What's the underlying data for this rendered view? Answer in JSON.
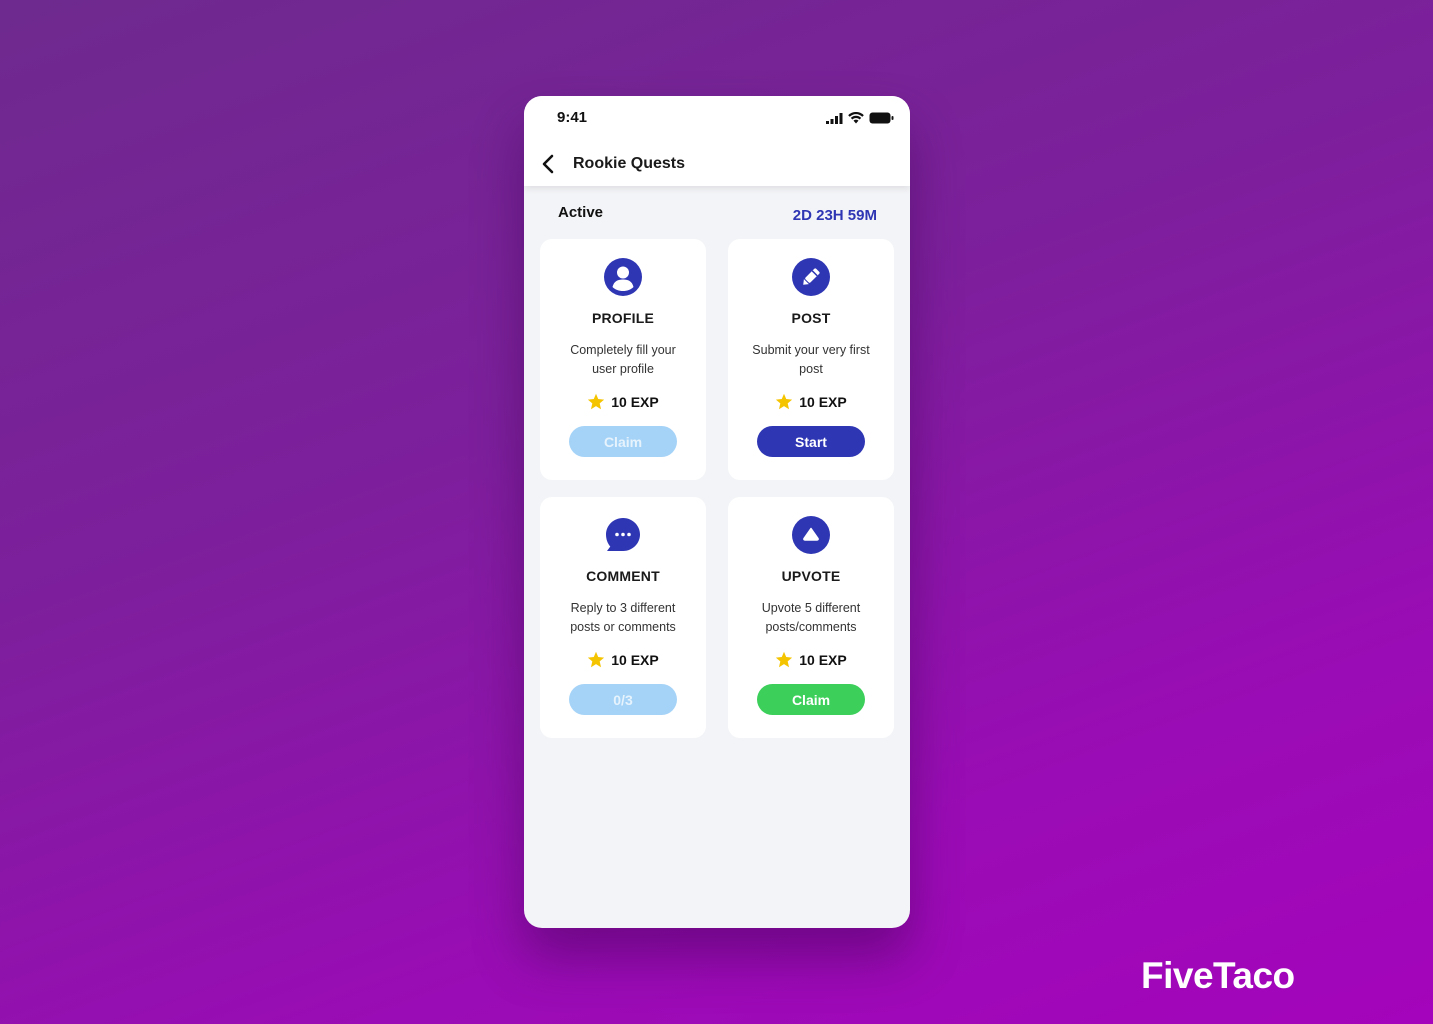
{
  "status_bar": {
    "time": "9:41",
    "icons": [
      "signal-icon",
      "wifi-icon",
      "battery-icon"
    ]
  },
  "header": {
    "title": "Rookie Quests",
    "back_icon": "chevron-left-icon"
  },
  "section": {
    "label": "Active",
    "timer": "2D 23H 59M"
  },
  "quests": [
    {
      "icon": "user-icon",
      "title": "PROFILE",
      "description": "Completely fill your user profile",
      "reward": "10 EXP",
      "button": "Claim",
      "button_state": "disabled"
    },
    {
      "icon": "pencil-icon",
      "title": "POST",
      "description": "Submit your very first post",
      "reward": "10 EXP",
      "button": "Start",
      "button_state": "primary"
    },
    {
      "icon": "comment-icon",
      "title": "COMMENT",
      "description": "Reply to 3 different posts or comments",
      "reward": "10 EXP",
      "button": "0/3",
      "button_state": "disabled",
      "progress": {
        "done": 0,
        "total": 3
      }
    },
    {
      "icon": "upvote-icon",
      "title": "UPVOTE",
      "description": "Upvote 5 different posts/comments",
      "reward": "10 EXP",
      "button": "Claim",
      "button_state": "success"
    }
  ],
  "colors": {
    "accent": "#2f36b4",
    "success": "#3ccf5a",
    "disabled": "#a5d3f7",
    "star": "#f5c400"
  },
  "brand": "FiveTaco"
}
